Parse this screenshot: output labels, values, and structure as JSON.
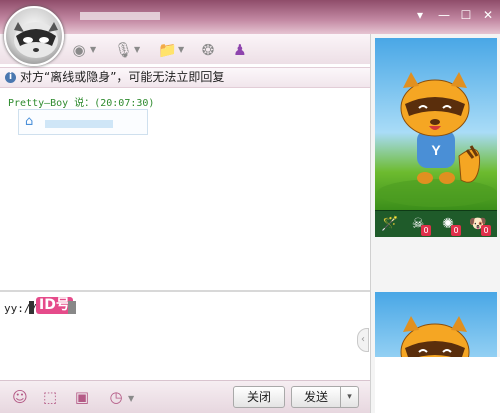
{
  "titlebar": {
    "controls": [
      {
        "name": "dropdown",
        "glyph": "▾"
      },
      {
        "name": "minimize",
        "glyph": "—"
      },
      {
        "name": "maximize",
        "glyph": "☐"
      },
      {
        "name": "close",
        "glyph": "✕"
      }
    ]
  },
  "toolbar": {
    "icons": [
      {
        "name": "camera-icon",
        "glyph": "◉"
      },
      {
        "name": "microphone-icon",
        "glyph": "🎙"
      },
      {
        "name": "folder-icon",
        "glyph": "📁"
      },
      {
        "name": "chat-bubble-icon",
        "glyph": "❂"
      },
      {
        "name": "person-icon",
        "glyph": "♟"
      }
    ]
  },
  "notice": {
    "icon": "i",
    "text": "对方“离线或隐身”，可能无法立即回复"
  },
  "chat": {
    "sender_line": "Pretty—Boy 说：(20:07:30)",
    "message_icon": "⌂"
  },
  "input": {
    "text": "yy://",
    "stamp": "ID号"
  },
  "bottombar": {
    "icons": [
      {
        "name": "emoji-icon",
        "glyph": "☺"
      },
      {
        "name": "screenshot-icon",
        "glyph": "⬚"
      },
      {
        "name": "image-icon",
        "glyph": "▣"
      },
      {
        "name": "history-icon",
        "glyph": "◷"
      }
    ],
    "close_label": "关闭",
    "send_label": "发送",
    "send_more": "▾"
  },
  "gifts": [
    {
      "name": "wand-gift-icon",
      "glyph": "🪄",
      "count": ""
    },
    {
      "name": "skull-gift-icon",
      "glyph": "☠",
      "count": "0"
    },
    {
      "name": "cake-gift-icon",
      "glyph": "✺",
      "count": "0"
    },
    {
      "name": "dog-gift-icon",
      "glyph": "🐶",
      "count": "0"
    }
  ],
  "colors": {
    "titlebar": "#b37594",
    "notice_bg": "#f4eaef",
    "sender": "#2e8b2e",
    "id_stamp": "#e54b8a",
    "mascot": "#f5a623"
  }
}
